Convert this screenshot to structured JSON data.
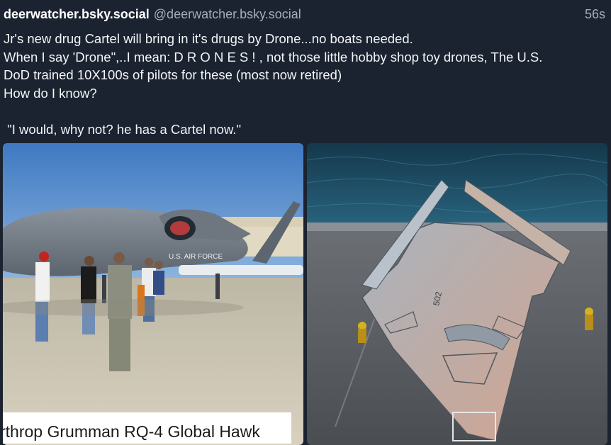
{
  "post": {
    "display_name": "deerwatcher.bsky.social",
    "handle": "@deerwatcher.bsky.social",
    "time": "56s",
    "text": "Jr's new drug Cartel will bring in it's drugs by Drone...no boats needed.\nWhen I say 'Drone\",..I mean: D R O N E S ! , not those little hobby shop toy drones, The U.S.\nDoD trained 10X100s of pilots for these (most now retired)\nHow do I know?\n\n \"I would, why not? he has a Cartel now.\""
  },
  "images": {
    "left": {
      "fuselage_text": "U.S. AIR FORCE",
      "caption": "rthrop Grumman RQ-4 Global Hawk"
    },
    "right": {
      "hull_number": "502"
    }
  },
  "colors": {
    "background": "#1b2330",
    "sky": "#4f86c8",
    "sea": "#1f4f68",
    "deck": "#5a5e63"
  }
}
